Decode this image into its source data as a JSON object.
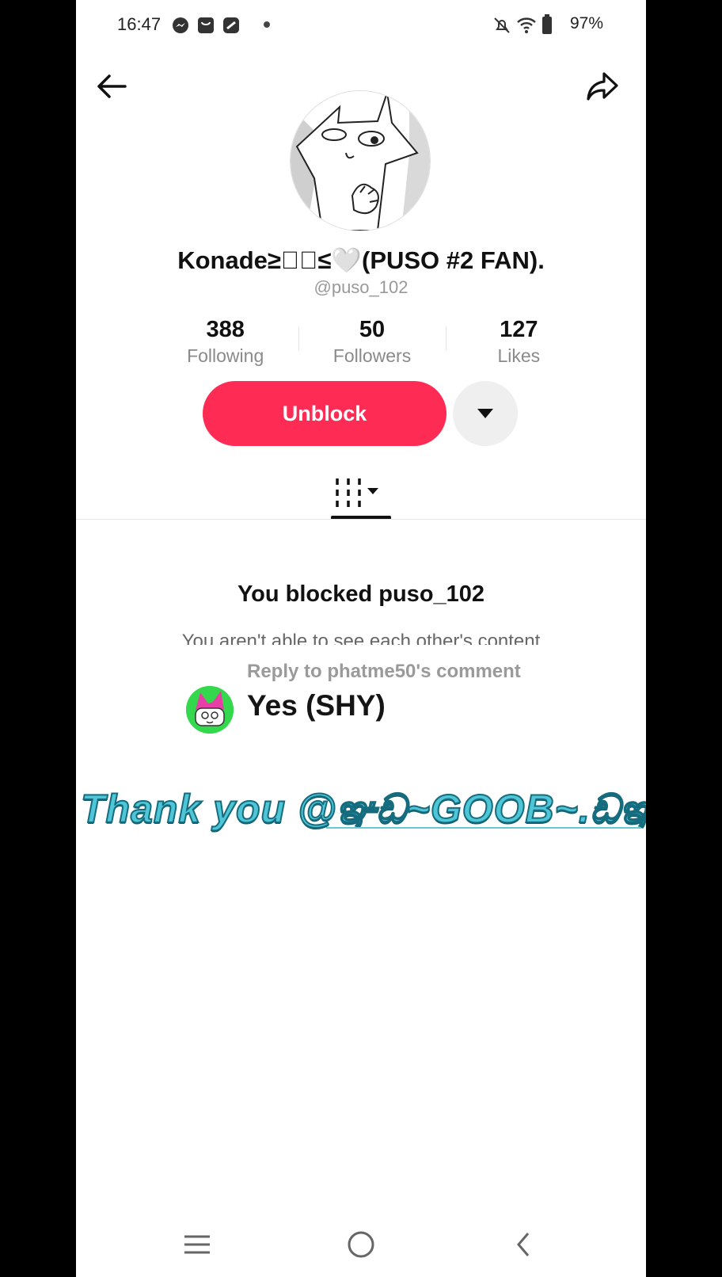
{
  "status_bar": {
    "time": "16:47",
    "battery": "97%",
    "icons": [
      "messenger-icon",
      "bag-icon",
      "app-icon",
      "dot-icon",
      "mute-icon",
      "wifi-icon",
      "battery-icon"
    ]
  },
  "profile": {
    "name": "Konade≥ᡃ⃝≤🤍(PUSO #2 FAN).",
    "handle": "@puso_102",
    "stats": [
      {
        "value": "388",
        "label": "Following"
      },
      {
        "value": "50",
        "label": "Followers"
      },
      {
        "value": "127",
        "label": "Likes"
      }
    ],
    "unblock_label": "Unblock"
  },
  "blocked": {
    "title": "You blocked puso_102",
    "subtitle": "You aren't able to see each other's content"
  },
  "overlay": {
    "reply_label": "Reply to phatme50's comment",
    "reply_text": "Yes (SHY)",
    "thanks_text": "Thank you @ఞඩ~GOOB~.ඩఞ"
  },
  "colors": {
    "accent": "#fe2c55",
    "thanks_fill": "#4fc6d6",
    "thanks_stroke": "#156c7e"
  }
}
